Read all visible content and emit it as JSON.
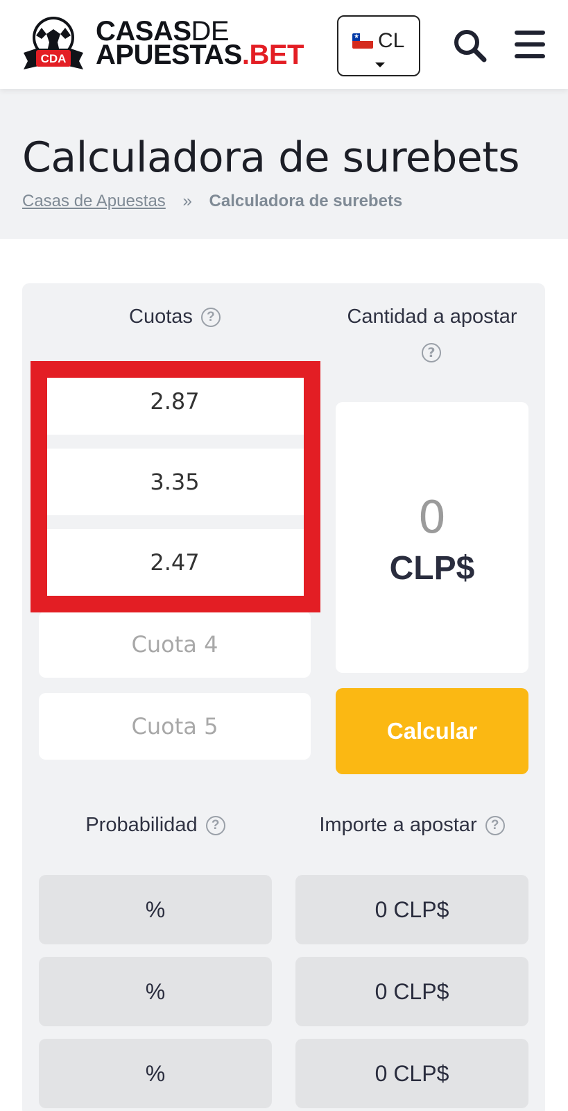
{
  "header": {
    "logo_badge_text": "CDA",
    "logo_line1_bold": "CASAS",
    "logo_line1_light": "DE",
    "logo_line2_main": "APUESTAS",
    "logo_line2_accent": ".BET",
    "country_code": "CL",
    "search_icon": "search-icon",
    "menu_icon": "hamburger-menu-icon"
  },
  "title": "Calculadora de surebets",
  "breadcrumb": {
    "home": "Casas de Apuestas",
    "separator": "»",
    "current": "Calculadora de surebets"
  },
  "calculator": {
    "odds_header": "Cuotas",
    "stake_header": "Cantidad a apostar",
    "help_glyph": "?",
    "odds": [
      {
        "value": "2.87"
      },
      {
        "value": "3.35"
      },
      {
        "value": "2.47"
      },
      {
        "value": "",
        "placeholder": "Cuota 4"
      },
      {
        "value": "",
        "placeholder": "Cuota 5"
      }
    ],
    "stake_value": "0",
    "stake_currency": "CLP$",
    "calculate_label": "Calcular",
    "probability_header": "Probabilidad",
    "amount_header": "Importe a apostar",
    "probabilities": [
      "%",
      "%",
      "%"
    ],
    "amounts": [
      "0 CLP$",
      "0 CLP$",
      "0 CLP$"
    ]
  },
  "colors": {
    "accent_red": "#e31e24",
    "button_yellow": "#fbb813",
    "text_dark": "#2a2d3e"
  }
}
